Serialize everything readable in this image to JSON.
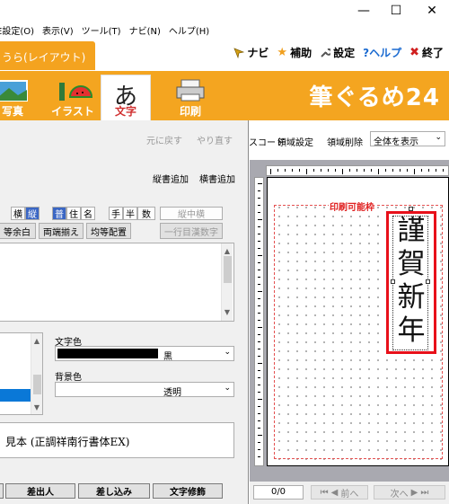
{
  "menubar": {
    "items": [
      "E設定(O)",
      "表示(V)",
      "ツール(T)",
      "ナビ(N)",
      "ヘルプ(H)"
    ]
  },
  "window": {
    "minimize": "—",
    "maximize": "☐",
    "close": "✕"
  },
  "tab": {
    "active_label": "うら(レイアウト)"
  },
  "top_tools": [
    {
      "icon": "navi-arrow-icon",
      "label": "ナビ",
      "color": "#d4a017"
    },
    {
      "icon": "star-icon",
      "label": "補助",
      "color": "#f0a020"
    },
    {
      "icon": "wrench-icon",
      "label": "設定",
      "color": "#555555"
    },
    {
      "icon": "help-icon",
      "label": "?ヘルプ",
      "color": "#1a6ad0"
    },
    {
      "icon": "exit-icon",
      "label": "終了",
      "color": "#d02020"
    }
  ],
  "ribbon": {
    "buttons": [
      {
        "label": "写真",
        "icon": "photo-icon"
      },
      {
        "label": "イラスト",
        "icon": "illustration-icon"
      },
      {
        "label": "文字",
        "icon": "text-icon",
        "glyph": "あ",
        "active": true
      },
      {
        "label": "印刷",
        "icon": "printer-icon"
      }
    ],
    "logo": "筆ぐるめ24"
  },
  "dialog": {
    "undo": "元に戻す",
    "redo": "やり直す",
    "add_vertical": "縦書追加",
    "add_horizontal": "横書追加",
    "direction": [
      "横",
      "縦"
    ],
    "kind": [
      "普",
      "住",
      "名"
    ],
    "width": [
      "手",
      "半",
      "数"
    ],
    "vertical_in_horizontal": "縦中横",
    "spacing_row": [
      "等余白",
      "両端揃え",
      "均等配置"
    ],
    "kanji_one_line": "一行目漢数字",
    "text_color_label": "文字色",
    "text_color_value": "黒",
    "bg_color_label": "背景色",
    "bg_color_value": "透明",
    "font_preview": "見本 (正調祥南行書体EX)",
    "bottom_buttons": [
      "差出人",
      "差し込み",
      "文字修飾"
    ]
  },
  "right_toolbar": {
    "items": [
      "スコード",
      "領域設定",
      "領域削除"
    ],
    "view_select": "全体を表示"
  },
  "canvas": {
    "print_area_label": "印刷可能枠",
    "vertical_text": "謹賀新年"
  },
  "status": {
    "page_count": "0/0",
    "prev": "前へ",
    "next": "次へ"
  }
}
